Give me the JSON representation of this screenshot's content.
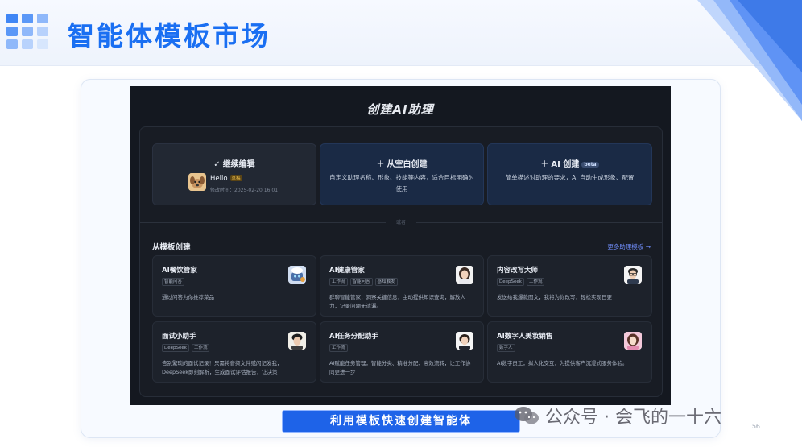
{
  "slide": {
    "title": "智能体模板市场",
    "caption": "利用模板快速创建智能体",
    "watermark": "公众号 · 会飞的一十六",
    "page_number": "56",
    "accent_color": "#1a6ff2"
  },
  "app": {
    "title": "创建AI助理",
    "top_cards": {
      "continue_edit": {
        "title": "继续编辑",
        "icon": "check-circle-icon",
        "draft_name": "Hello",
        "draft_badge": "草稿",
        "modified": "修改时间：2025-02-20 16:01"
      },
      "blank": {
        "title": "从空白创建",
        "icon": "plus-icon",
        "description": "自定义助理名称、形象、技能等内容，适合目标明确时使用"
      },
      "ai_create": {
        "title": "AI 创建",
        "badge": "beta",
        "icon": "plus-icon",
        "description": "简单描述对助理的要求，AI 自动生成形象、配置"
      }
    },
    "divider_text": "或者",
    "templates_section": {
      "title": "从模板创建",
      "more_link": "更多助理模板",
      "templates": [
        {
          "name": "AI餐饮管家",
          "tags": [
            "智能问答"
          ],
          "description": "通过问答为你推荐菜品",
          "avatar": "chef-robot-avatar"
        },
        {
          "name": "AI健康管家",
          "tags": [
            "工作流",
            "智能问答",
            "感知触发"
          ],
          "description": "群聊智能管家，洞察关键信息，主动提供知识查询，解放人力，记录问题无遗漏。",
          "avatar": "woman-avatar"
        },
        {
          "name": "内容改写大师",
          "tags": [
            "DeepSeek",
            "工作流"
          ],
          "description": "发送给我爆款图文，我将为你改写，轻松实现日更",
          "avatar": "man-glasses-avatar"
        },
        {
          "name": "面试小助手",
          "tags": [
            "DeepSeek",
            "工作流"
          ],
          "description": "告别繁琐的面试记录！只需将音频文件或闪记发我，DeepSeek即刻解析，生成面试评估报告，让决策",
          "avatar": "man-avatar"
        },
        {
          "name": "AI任务分配助手",
          "tags": [
            "工作流"
          ],
          "description": "AI赋能任务管理，智能分类、精准分配、高效流转，让工作协同更进一步",
          "avatar": "woman-suit-avatar"
        },
        {
          "name": "AI数字人美妆销售",
          "tags": [
            "数字人"
          ],
          "description": "AI数字员工，拟人化交互，为提供客户沉浸式服务体验。",
          "avatar": "makeup-woman-avatar"
        }
      ]
    }
  }
}
